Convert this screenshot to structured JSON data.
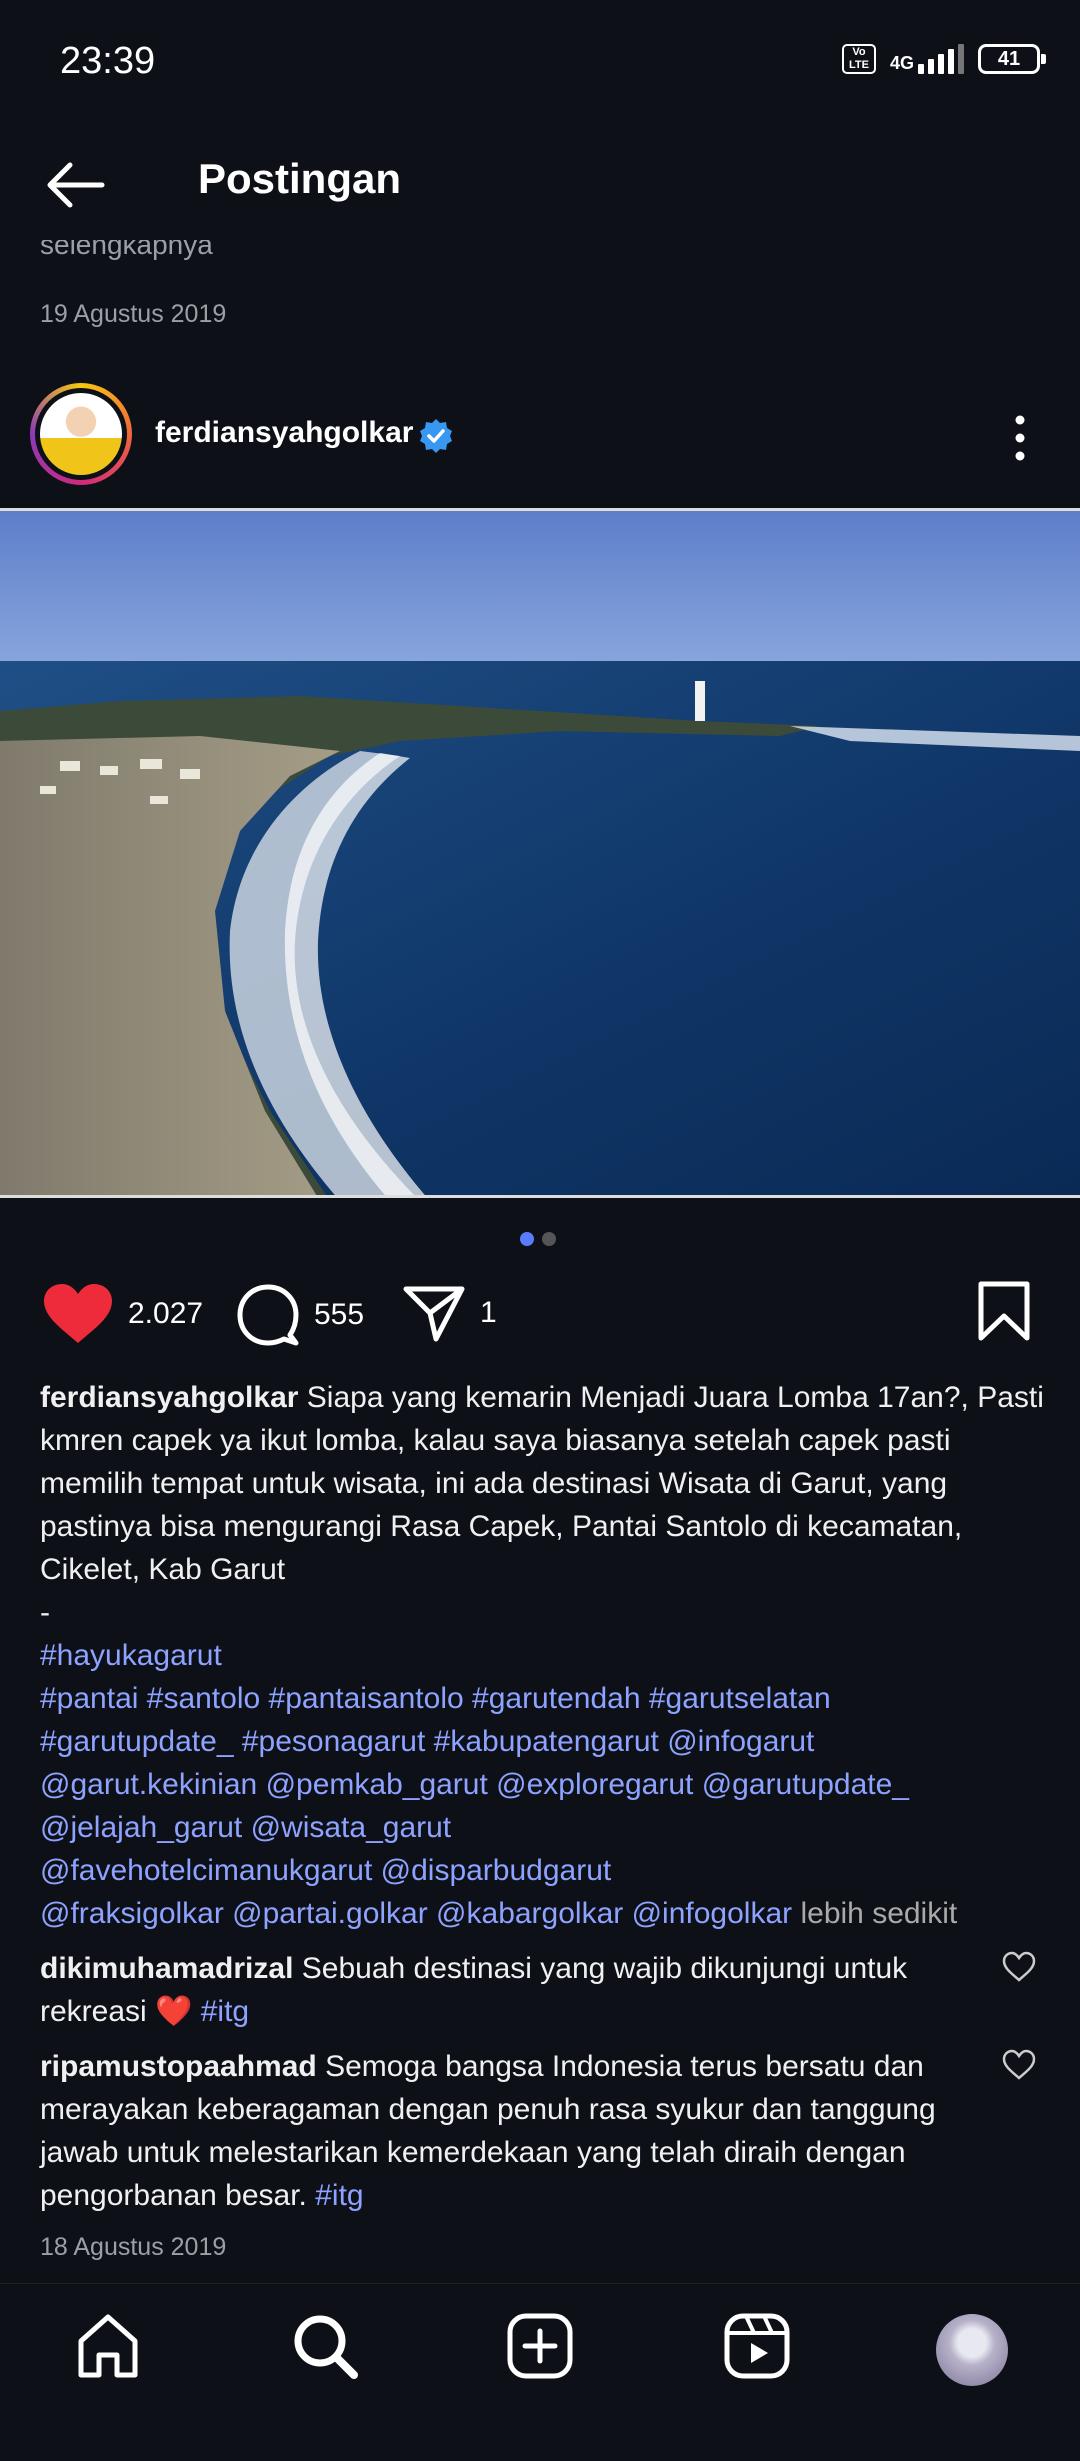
{
  "status_bar": {
    "time": "23:39",
    "volte": "Vo\nLTE",
    "network": "4G",
    "battery": "41"
  },
  "header": {
    "title": "Postingan"
  },
  "previous_post": {
    "more_text": "selengkapnya",
    "date": "19 Agustus 2019"
  },
  "post": {
    "username": "ferdiansyahgolkar",
    "verified": true,
    "likes": "2.027",
    "comments": "555",
    "shares": "1",
    "caption_user": "ferdiansyahgolkar",
    "caption_text": "Siapa yang kemarin Menjadi Juara Lomba 17an?, Pasti kmren capek ya ikut lomba, kalau saya biasanya setelah capek pasti memilih tempat untuk wisata, ini ada destinasi Wisata di Garut, yang pastinya bisa mengurangi Rasa Capek, Pantai Santolo di kecamatan, Cikelet, Kab Garut",
    "separator": "-",
    "hashtags_line1": "#hayukagarut",
    "hashtags_line2": "#pantai #santolo #pantaisantolo #garutendah #garutselatan",
    "hashtags_line3": "#garutupdate_ #pesonagarut #kabupatengarut @infogarut",
    "hashtags_line4": "@garut.kekinian @pemkab_garut @exploregarut @garutupdate_",
    "hashtags_line5": "@jelajah_garut @wisata_garut",
    "hashtags_line6": "@favehotelcimanukgarut @disparbudgarut",
    "hashtags_line7": "@fraksigolkar @partai.golkar @kabargolkar @infogolkar",
    "less_label": "lebih sedikit",
    "date": "18 Agustus 2019",
    "carousel_count": 2,
    "carousel_active": 1
  },
  "comments": [
    {
      "user": "dikimuhamadrizal",
      "text": "Sebuah destinasi yang wajib dikunjungi untuk rekreasi ❤️",
      "tag": "#itg"
    },
    {
      "user": "ripamustopaahmad",
      "text": "Semoga bangsa Indonesia terus bersatu dan merayakan keberagaman dengan penuh rasa syukur dan tanggung jawab untuk melestarikan kemerdekaan yang telah diraih dengan pengorbanan besar.",
      "tag": "#itg"
    }
  ],
  "colors": {
    "background": "#0d1117",
    "like_red": "#ee2b3b",
    "link_blue": "#8ea2ff",
    "verified_blue": "#3897f0"
  },
  "nav": [
    "home-icon",
    "search-icon",
    "create-icon",
    "reels-icon",
    "profile-avatar"
  ]
}
